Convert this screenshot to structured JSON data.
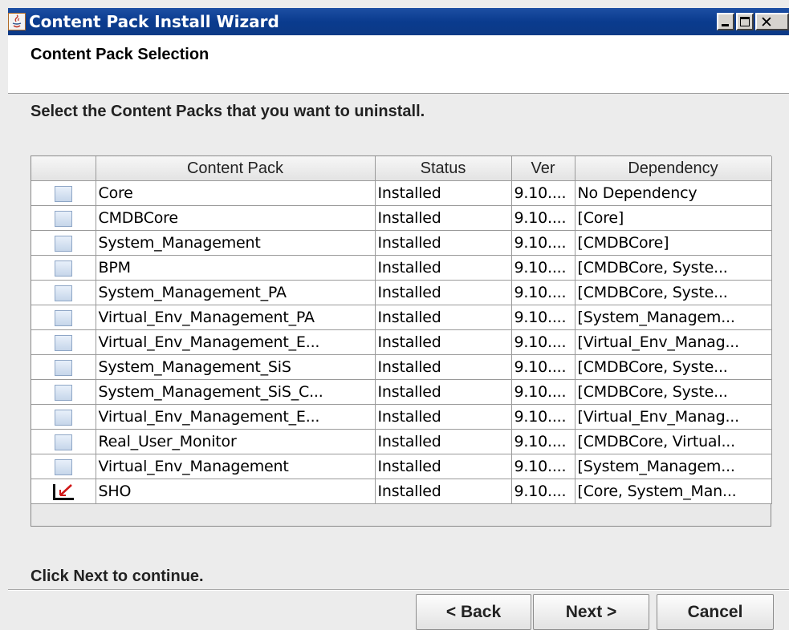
{
  "window": {
    "title": "Content Pack Install Wizard",
    "icon": "java-app-icon",
    "controls": [
      "minimize",
      "maximize",
      "close"
    ]
  },
  "header": {
    "title": "Content Pack Selection"
  },
  "instruction": "Select the Content Packs that you want to uninstall.",
  "table": {
    "columns": [
      "",
      "Content Pack",
      "Status",
      "Ver",
      "Dependency"
    ],
    "rows": [
      {
        "checked": false,
        "name": "Core",
        "status": "Installed",
        "ver": "9.10....",
        "dependency": "No Dependency"
      },
      {
        "checked": false,
        "name": "CMDBCore",
        "status": "Installed",
        "ver": "9.10....",
        "dependency": "[Core]"
      },
      {
        "checked": false,
        "name": "System_Management",
        "status": "Installed",
        "ver": "9.10....",
        "dependency": "[CMDBCore]"
      },
      {
        "checked": false,
        "name": "BPM",
        "status": "Installed",
        "ver": "9.10....",
        "dependency": "[CMDBCore, Syste..."
      },
      {
        "checked": false,
        "name": "System_Management_PA",
        "status": "Installed",
        "ver": "9.10....",
        "dependency": "[CMDBCore, Syste..."
      },
      {
        "checked": false,
        "name": "Virtual_Env_Management_PA",
        "status": "Installed",
        "ver": "9.10....",
        "dependency": "[System_Managem..."
      },
      {
        "checked": false,
        "name": "Virtual_Env_Management_E...",
        "status": "Installed",
        "ver": "9.10....",
        "dependency": "[Virtual_Env_Manag..."
      },
      {
        "checked": false,
        "name": "System_Management_SiS",
        "status": "Installed",
        "ver": "9.10....",
        "dependency": "[CMDBCore, Syste..."
      },
      {
        "checked": false,
        "name": "System_Management_SiS_C...",
        "status": "Installed",
        "ver": "9.10....",
        "dependency": "[CMDBCore, Syste..."
      },
      {
        "checked": false,
        "name": "Virtual_Env_Management_E...",
        "status": "Installed",
        "ver": "9.10....",
        "dependency": "[Virtual_Env_Manag..."
      },
      {
        "checked": false,
        "name": "Real_User_Monitor",
        "status": "Installed",
        "ver": "9.10....",
        "dependency": "[CMDBCore, Virtual..."
      },
      {
        "checked": false,
        "name": "Virtual_Env_Management",
        "status": "Installed",
        "ver": "9.10....",
        "dependency": "[System_Managem..."
      },
      {
        "checked": true,
        "name": "SHO",
        "status": "Installed",
        "ver": "9.10....",
        "dependency": "[Core, System_Man..."
      }
    ]
  },
  "footer": {
    "message": "Click Next to continue.",
    "back_label": "< Back",
    "next_label": "Next >",
    "cancel_label": "Cancel"
  }
}
